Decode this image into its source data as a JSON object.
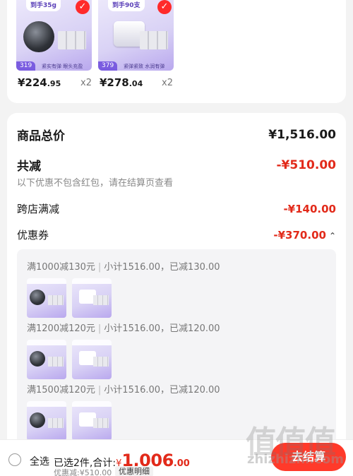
{
  "products": [
    {
      "banner": "到手35g",
      "price_tag": "319",
      "footer": "紧实有弹 眼头充盈",
      "price_int": "¥224",
      "price_dec": ".95",
      "qty": "x2"
    },
    {
      "banner": "到手90支",
      "price_tag": "379",
      "footer": "紧弹紧致 水润有弹",
      "price_int": "¥278",
      "price_dec": ".04",
      "qty": "x2"
    }
  ],
  "summary": {
    "total_label": "商品总价",
    "total_value": "¥1,516.00",
    "reduce_label": "共减",
    "reduce_value": "-¥510.00",
    "note": "以下优惠不包含红包，请在结算页查看",
    "cross_store_label": "跨店满减",
    "cross_store_value": "-¥140.00",
    "coupon_label": "优惠券",
    "coupon_value": "-¥370.00",
    "caret": "⌃"
  },
  "coupons": [
    {
      "rule": "满1000减130元",
      "detail": "小计1516.00，已减130.00"
    },
    {
      "rule": "满1200减120元",
      "detail": "小计1516.00，已减120.00"
    },
    {
      "rule": "满1500减120元",
      "detail": "小计1516.00，已减120.00"
    }
  ],
  "separator": "|",
  "bottom_bar": {
    "select_all": "全选",
    "picked_text": "已选2件,合计:",
    "currency": "¥",
    "total_int": "1,006",
    "total_dec": ".00",
    "discount_note": "优惠减:¥510.00",
    "detail_button": "优惠明细",
    "checkout_button": "去结算"
  },
  "icons": {
    "check": "check-circle-icon",
    "radio": "radio-unchecked-icon",
    "caret": "chevron-up-icon"
  },
  "watermark": {
    "glyphs": "值值值",
    "text": "zhizhizhi.com"
  },
  "colors": {
    "accent_red": "#e22a1a",
    "checkout_red": "#ff3a2a",
    "product_purple": "#7a5ce0"
  }
}
